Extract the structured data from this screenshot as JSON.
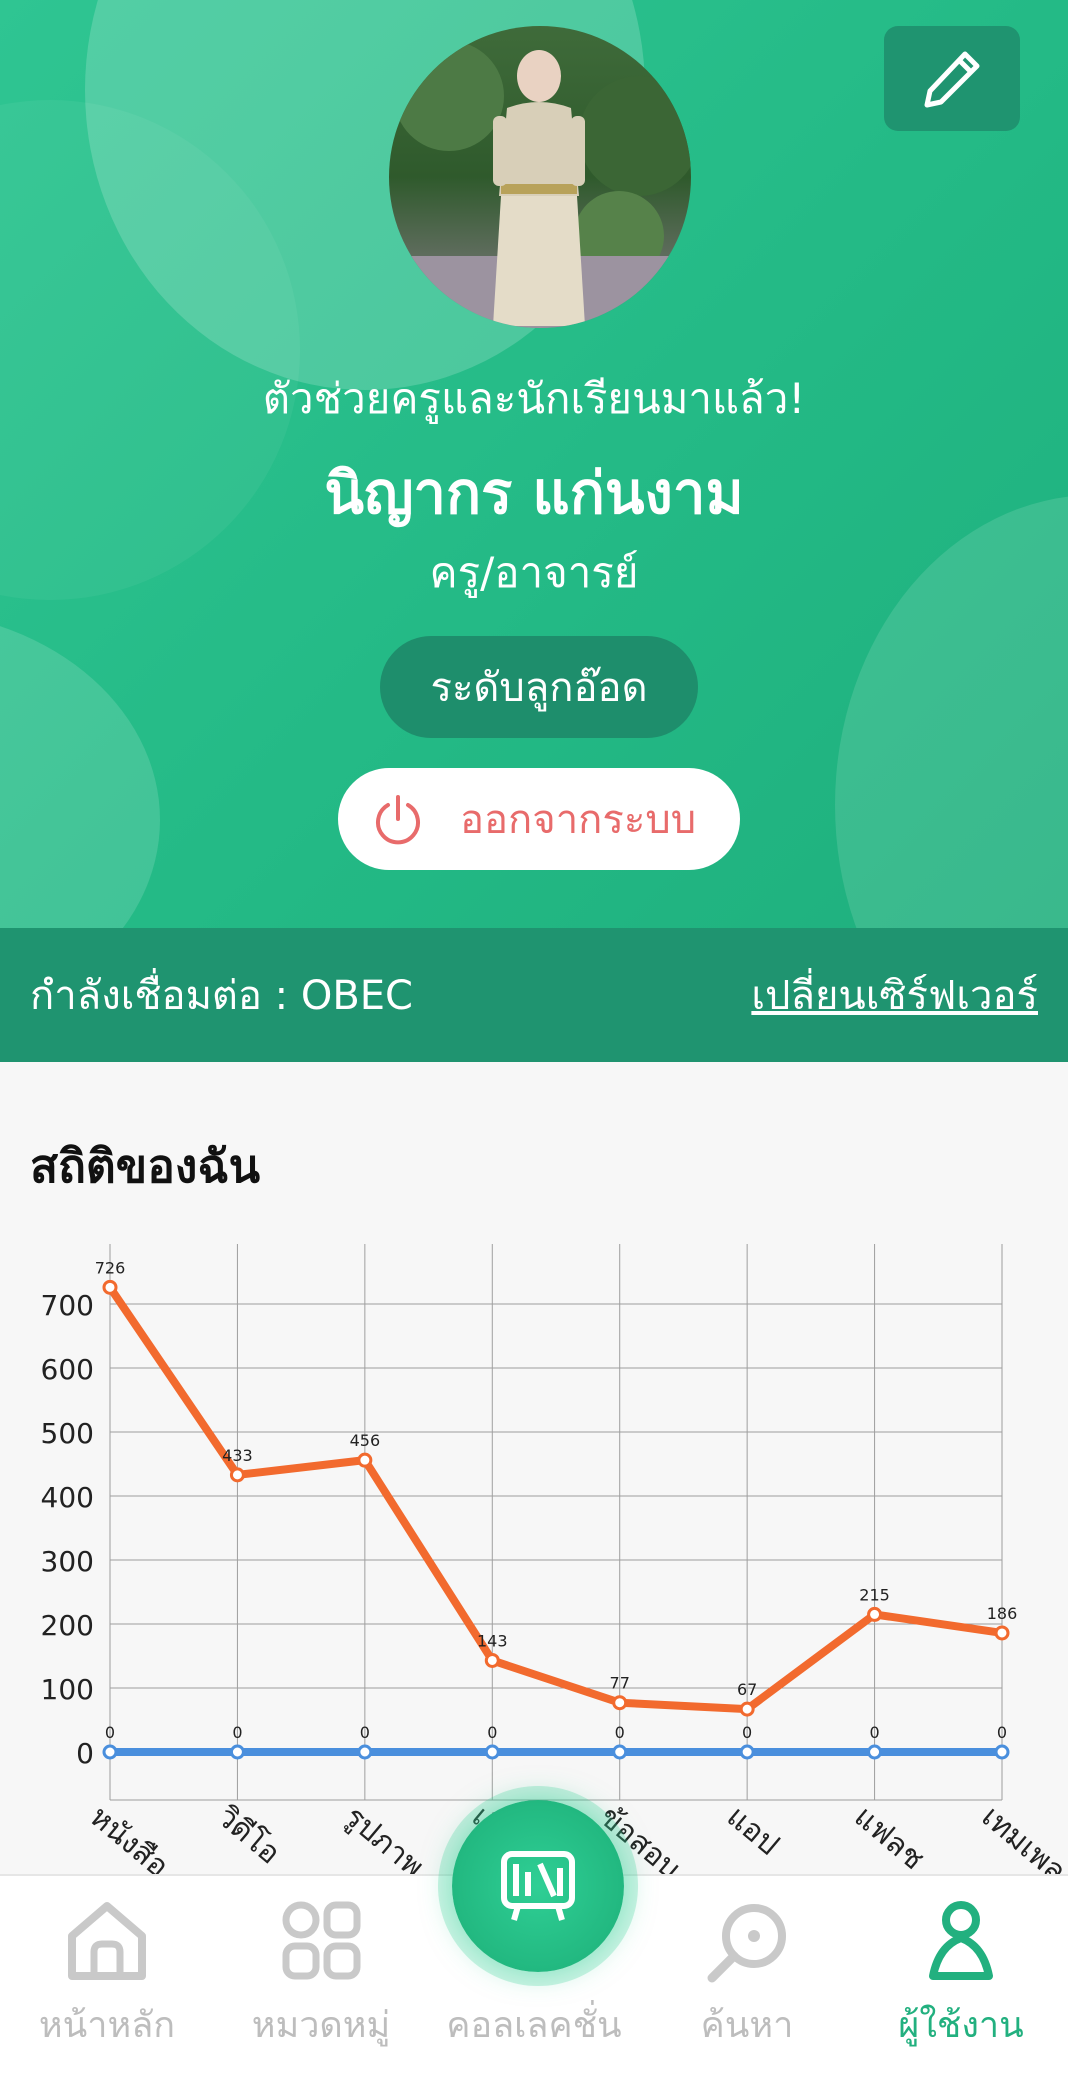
{
  "header": {
    "tagline": "ตัวช่วยครูและนักเรียนมาแล้ว!",
    "user_name": "นิญากร แก่นงาม",
    "role": "ครู/อาจารย์",
    "level": "ระดับลูกอ๊อด",
    "logout_label": "ออกจากระบบ"
  },
  "server": {
    "connection_label": "กำลังเชื่อมต่อ : OBEC",
    "switch_label": "เปลี่ยนเซิร์ฟเวอร์"
  },
  "stats": {
    "title": "สถิติของฉัน"
  },
  "chart_data": {
    "type": "line",
    "categories": [
      "หนังสือ",
      "วิดีโอ",
      "รูปภาพ",
      "เสียง",
      "ข้อสอบ",
      "แอป",
      "แฟลช",
      "เทมเพลต"
    ],
    "series": [
      {
        "values": [
          726,
          433,
          456,
          143,
          77,
          67,
          215,
          186
        ],
        "color": "#f26a2e"
      },
      {
        "values": [
          0,
          0,
          0,
          0,
          0,
          0,
          0,
          0
        ],
        "color": "#4a8fdd"
      }
    ],
    "ylim": [
      0,
      800
    ],
    "yticks": [
      0,
      100,
      200,
      300,
      400,
      500,
      600,
      700
    ],
    "grid": true
  },
  "nav": {
    "items": [
      {
        "label": "หน้าหลัก",
        "icon": "home-icon"
      },
      {
        "label": "หมวดหมู่",
        "icon": "category-icon"
      },
      {
        "label": "คอลเลคชั่น",
        "icon": "collection-icon"
      },
      {
        "label": "ค้นหา",
        "icon": "search-icon"
      },
      {
        "label": "ผู้ใช้งาน",
        "icon": "user-icon"
      }
    ],
    "active_color": "#22b07f",
    "inactive_color": "#bdbdbd"
  }
}
